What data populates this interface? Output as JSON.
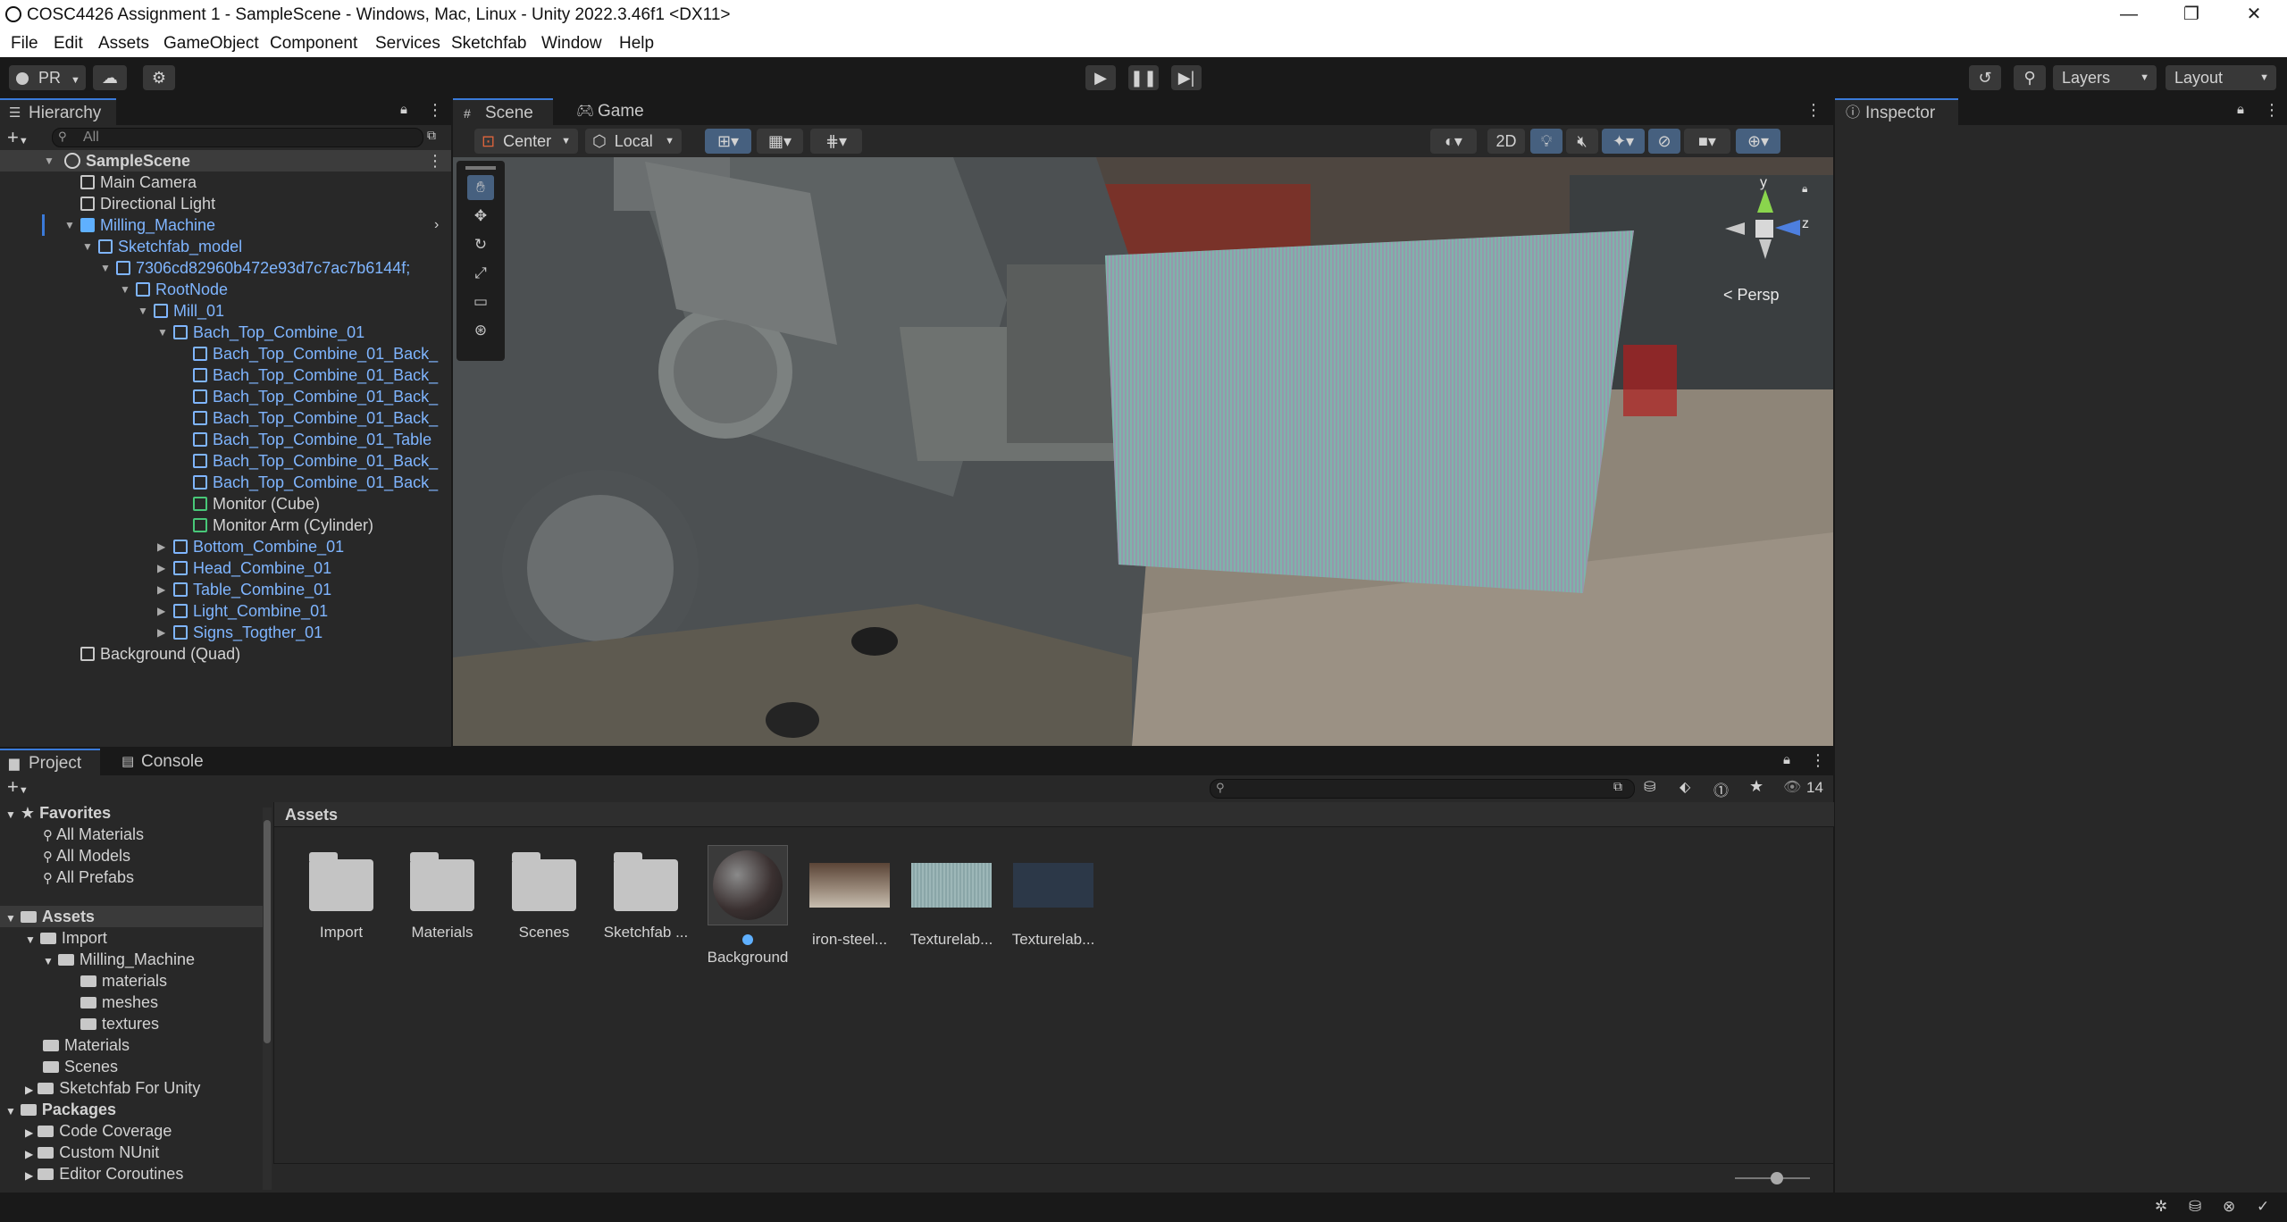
{
  "window": {
    "title": "COSC4426 Assignment 1 - SampleScene - Windows, Mac, Linux - Unity 2022.3.46f1 <DX11>",
    "controls": [
      "—",
      "❐",
      "✕"
    ]
  },
  "menu": [
    "File",
    "Edit",
    "Assets",
    "GameObject",
    "Component",
    "Services",
    "Sketchfab",
    "Window",
    "Help"
  ],
  "toolbar": {
    "account": "PR",
    "layers": "Layers",
    "layout": "Layout"
  },
  "hierarchy": {
    "tab": "Hierarchy",
    "search_placeholder": "All",
    "rows": [
      {
        "label": "SampleScene"
      },
      {
        "label": "Main Camera"
      },
      {
        "label": "Directional Light"
      },
      {
        "label": "Milling_Machine"
      },
      {
        "label": "Sketchfab_model"
      },
      {
        "label": "7306cd82960b472e93d7c7ac7b6144f;"
      },
      {
        "label": "RootNode"
      },
      {
        "label": "Mill_01"
      },
      {
        "label": "Bach_Top_Combine_01"
      },
      {
        "label": "Bach_Top_Combine_01_Back_"
      },
      {
        "label": "Bach_Top_Combine_01_Back_"
      },
      {
        "label": "Bach_Top_Combine_01_Back_"
      },
      {
        "label": "Bach_Top_Combine_01_Back_"
      },
      {
        "label": "Bach_Top_Combine_01_Table"
      },
      {
        "label": "Bach_Top_Combine_01_Back_"
      },
      {
        "label": "Bach_Top_Combine_01_Back_"
      },
      {
        "label": "Monitor (Cube)"
      },
      {
        "label": "Monitor Arm (Cylinder)"
      },
      {
        "label": "Bottom_Combine_01"
      },
      {
        "label": "Head_Combine_01"
      },
      {
        "label": "Table_Combine_01"
      },
      {
        "label": "Light_Combine_01"
      },
      {
        "label": "Signs_Togther_01"
      },
      {
        "label": "Background (Quad)"
      }
    ]
  },
  "scene": {
    "tabs": [
      "Scene",
      "Game"
    ],
    "pivot": "Center",
    "space": "Local",
    "mode2d": "2D",
    "gizmo_y": "y",
    "gizmo_z": "z",
    "persp": "< Persp"
  },
  "inspector": {
    "tab": "Inspector"
  },
  "project": {
    "tabs": [
      "Project",
      "Console"
    ],
    "count": "14",
    "breadcrumb": "Assets",
    "favorites_header": "Favorites",
    "favorites": [
      "All Materials",
      "All Models",
      "All Prefabs"
    ],
    "assets_header": "Assets",
    "tree": [
      "Import",
      "Milling_Machine",
      "materials",
      "meshes",
      "textures",
      "Materials",
      "Scenes",
      "Sketchfab For Unity"
    ],
    "packages_header": "Packages",
    "packages": [
      "Code Coverage",
      "Custom NUnit",
      "Editor Coroutines"
    ],
    "items": [
      {
        "label": "Import",
        "kind": "folder"
      },
      {
        "label": "Materials",
        "kind": "folder"
      },
      {
        "label": "Scenes",
        "kind": "folder"
      },
      {
        "label": "Sketchfab ...",
        "kind": "folder"
      },
      {
        "label": "Background",
        "kind": "material"
      },
      {
        "label": "iron-steel...",
        "kind": "texture"
      },
      {
        "label": "Texturelab...",
        "kind": "texture"
      },
      {
        "label": "Texturelab...",
        "kind": "texture"
      }
    ]
  },
  "colors": {
    "accent": "#3a7ad9",
    "link_blue": "#7fb5ff",
    "panel": "#282828",
    "background": "#191919"
  }
}
